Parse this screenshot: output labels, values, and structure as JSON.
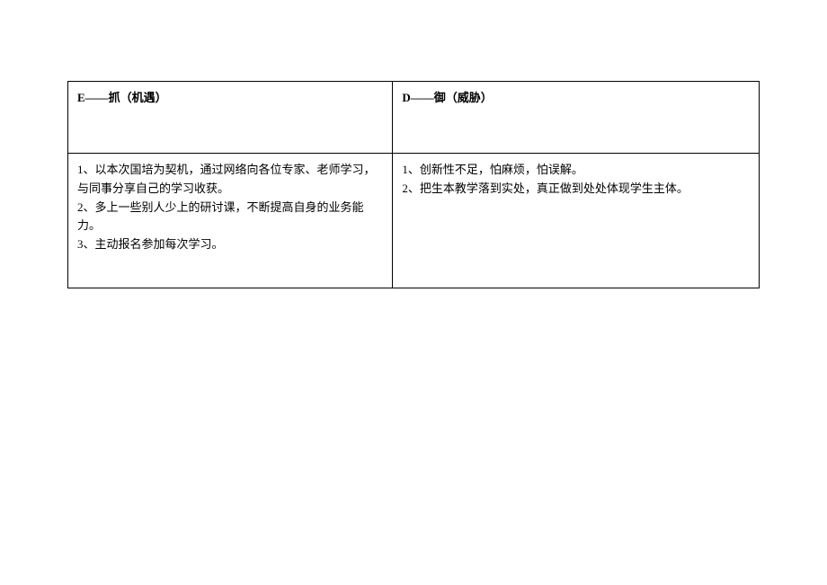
{
  "table": {
    "headers": {
      "left": "E——抓（机遇）",
      "right": "D——御（威胁）"
    },
    "content": {
      "left": {
        "item1": "1、以本次国培为契机，通过网络向各位专家、老师学习，与同事分享自己的学习收获。",
        "item2": "2、多上一些别人少上的研讨课，不断提高自身的业务能力。",
        "item3": "3、主动报名参加每次学习。"
      },
      "right": {
        "item1": "1、创新性不足，怕麻烦，怕误解。",
        "item2": "2、把生本教学落到实处，真正做到处处体现学生主体。"
      }
    }
  }
}
